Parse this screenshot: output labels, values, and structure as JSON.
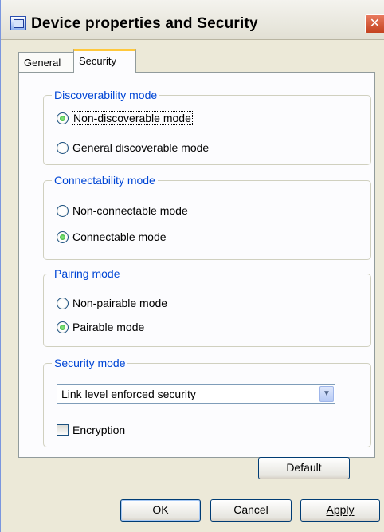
{
  "window": {
    "title": "Device properties and Security",
    "close_label": "✕"
  },
  "tabs": [
    {
      "label": "General",
      "selected": false
    },
    {
      "label": "Security",
      "selected": true
    }
  ],
  "discoverability": {
    "label": "Discoverability mode",
    "options": [
      {
        "label": "Non-discoverable mode",
        "checked": true
      },
      {
        "label": "General discoverable mode",
        "checked": false
      }
    ]
  },
  "connectability": {
    "label": "Connectability mode",
    "options": [
      {
        "label": "Non-connectable mode",
        "checked": false
      },
      {
        "label": "Connectable mode",
        "checked": true
      }
    ]
  },
  "pairing": {
    "label": "Pairing mode",
    "options": [
      {
        "label": "Non-pairable mode",
        "checked": false
      },
      {
        "label": "Pairable mode",
        "checked": true
      }
    ]
  },
  "security": {
    "label": "Security mode",
    "selected_value": "Link level enforced security",
    "encryption_label": "Encryption",
    "encryption_checked": false
  },
  "buttons": {
    "default_label": "Default",
    "ok_label": "OK",
    "cancel_label": "Cancel",
    "apply_label": "Apply"
  }
}
